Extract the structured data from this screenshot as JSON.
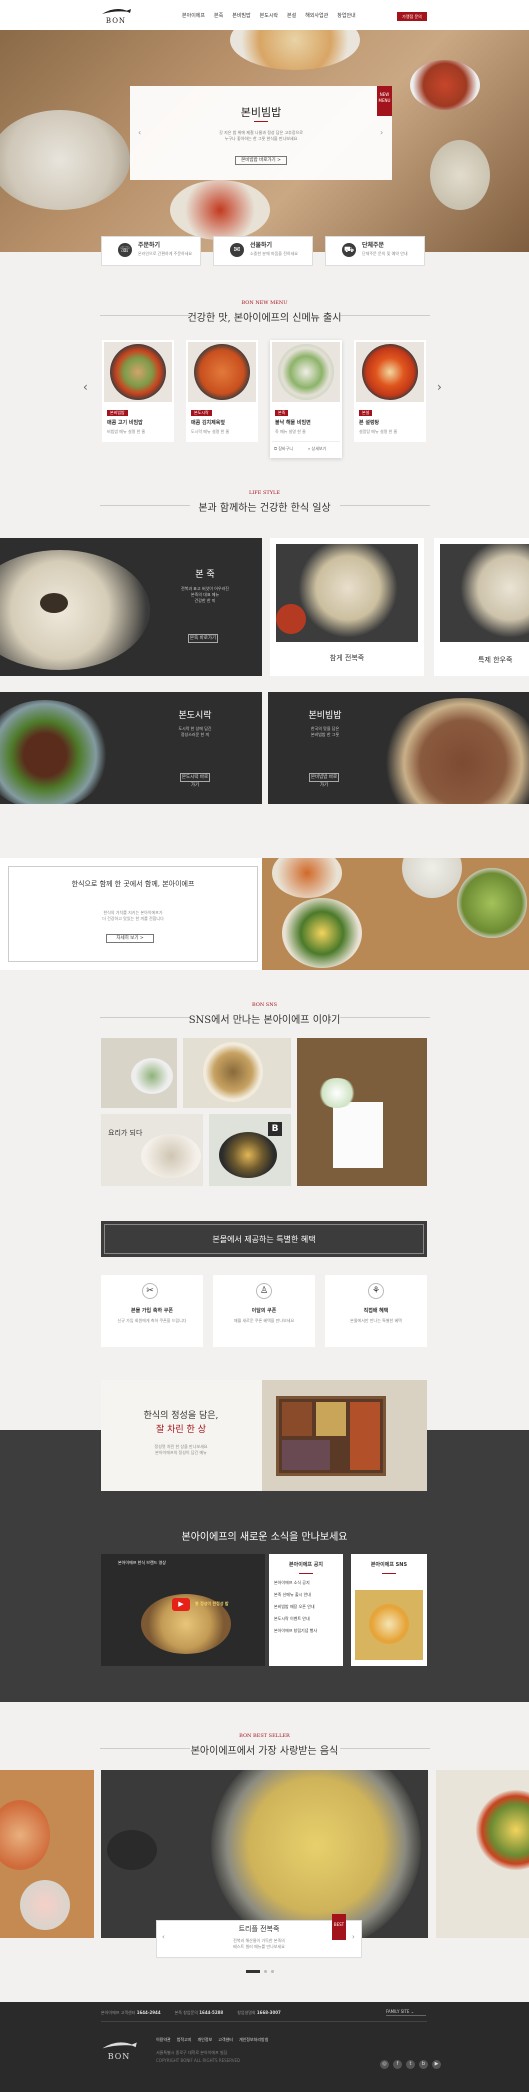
{
  "header": {
    "logo_text": "BON",
    "nav": [
      "본아이에프",
      "본죽",
      "본비빔밥",
      "본도시락",
      "본설",
      "해외사업관",
      "창업안내"
    ],
    "cta": "가맹점 문의"
  },
  "hero": {
    "title": "본비빔밥",
    "desc": [
      "갓 지은 밥 위에 제철 나물과 정성 담은 고추장으로",
      "누구나 좋아하는 한 그릇 한식을 만나보세요"
    ],
    "button": "본비빔밥 바로가기 >",
    "badge": "NEW\nMENU"
  },
  "quick": [
    {
      "label": "주문하기",
      "desc": "온라인으로 간편하게 주문하세요"
    },
    {
      "label": "선물하기",
      "desc": "소중한 분께 마음을 전하세요"
    },
    {
      "label": "단체주문",
      "desc": "단체주문 문의 및 예약 안내"
    }
  ],
  "new_menu": {
    "sub": "BON NEW MENU",
    "title": "건강한 맛, 본아이에프의 신메뉴 출시",
    "items": [
      {
        "tag": "본비빔밥",
        "name": "매콤 고기 비빔밥",
        "desc": "비빔밥 메뉴 설명 한 줄"
      },
      {
        "tag": "본도시락",
        "name": "매콤 김치제육덮",
        "desc": "도시락 메뉴 설명 한 줄"
      },
      {
        "tag": "본죽",
        "name": "불낙 해물 비빔면",
        "desc": "죽 메뉴 설명 한 줄"
      },
      {
        "tag": "본설",
        "name": "본 설렁탕",
        "desc": "설렁탕 메뉴 설명 한 줄"
      }
    ],
    "actions": [
      "장바구니",
      "상세보기"
    ]
  },
  "life": {
    "sub": "LIFE STYLE",
    "title": "본과 함께하는 건강한 한식 일상",
    "panels": [
      {
        "title": "본 죽",
        "desc": [
          "전복과 표고 버섯이 어우러진",
          "본죽의 대표 메뉴",
          "건강한 한 끼"
        ],
        "btn": "본죽 바로가기"
      },
      {
        "title": "본도시락",
        "desc": [
          "도시락 한 상에 담긴",
          "정성스러운 한 끼"
        ],
        "btn": "본도시락 바로가기"
      },
      {
        "title": "본비빔밥",
        "desc": [
          "한국의 맛을 담은",
          "본비빔밥 한 그릇"
        ],
        "btn": "본비빔밥 바로가기"
      }
    ],
    "cards": [
      "참게 전복죽",
      "특제 한우죽"
    ]
  },
  "brand": {
    "title": "한식으로 함께 한 곳에서 함께, 본아이에프",
    "desc": [
      "한식의 가치를 지키는 본아이에프가",
      "더 건강하고 맛있는 한 끼를 전합니다"
    ],
    "btn": "자세히 보기 >"
  },
  "sns": {
    "sub": "BON SNS",
    "title": "SNS에서 만나는 본아이에프 이야기",
    "badge": "B",
    "script": "요리가 되다"
  },
  "mall": {
    "title": "본몰에서 제공하는 특별한 혜택",
    "items": [
      {
        "title": "본몰 가입 축하 쿠폰",
        "desc": "신규 가입 회원에게 축하 쿠폰을 드립니다"
      },
      {
        "title": "이달의 쿠폰",
        "desc": "매월 새로운 쿠폰 혜택을 만나보세요"
      },
      {
        "title": "직접배 혜택",
        "desc": "본몰에서만 만나는 특별한 혜택"
      }
    ]
  },
  "table": {
    "title1": "한식의 정성을 담은,",
    "title2": "잘 차린 한 상",
    "desc": [
      "정성껏 차린 한 상을 만나보세요",
      "본아이에프의 정성이 담긴 메뉴"
    ]
  },
  "news": {
    "title": "본아이에프의 새로운 소식을 만나보세요",
    "video_title": "본아이에프 한식 브랜드 영상",
    "video_logo": "봉 정성이 한정성 밥",
    "notice_title": "본아이에프 공지",
    "notices": [
      "본아이에프 소식 공지",
      "본죽 신메뉴 출시 안내",
      "본비빔밥 매장 오픈 안내",
      "본도시락 이벤트 안내",
      "본아이에프 창립기념 행사"
    ],
    "sns_title": "본아이에프 SNS"
  },
  "best": {
    "sub": "BON BEST SELLER",
    "title": "본아이에프에서 가장 사랑받는 음식",
    "item_title": "트리플 전복죽",
    "item_desc": [
      "전복과 해산물이 가득한 본죽의",
      "베스트 셀러 메뉴를 만나보세요"
    ],
    "badge": "BEST"
  },
  "footer": {
    "phone_items": [
      {
        "label": "본아이에프 고객센터",
        "num": "1644-2944"
      },
      {
        "label": "본죽 창업문의",
        "num": "1644-5288"
      },
      {
        "label": "창업설명회",
        "num": "1668-3007"
      }
    ],
    "family": "FAMILY SITE",
    "links": [
      "이용약관",
      "법적고지",
      "개인정보",
      "고객센터",
      "개인정보처리방침"
    ],
    "logo_text": "BON",
    "address": "서울특별시 종로구 대학로 본아이에프 빌딩",
    "copyright": "COPYRIGHT BONIF ALL RIGHTS RESERVED"
  },
  "colors": {
    "accent": "#a3131b",
    "dark": "#3c3c3c"
  }
}
